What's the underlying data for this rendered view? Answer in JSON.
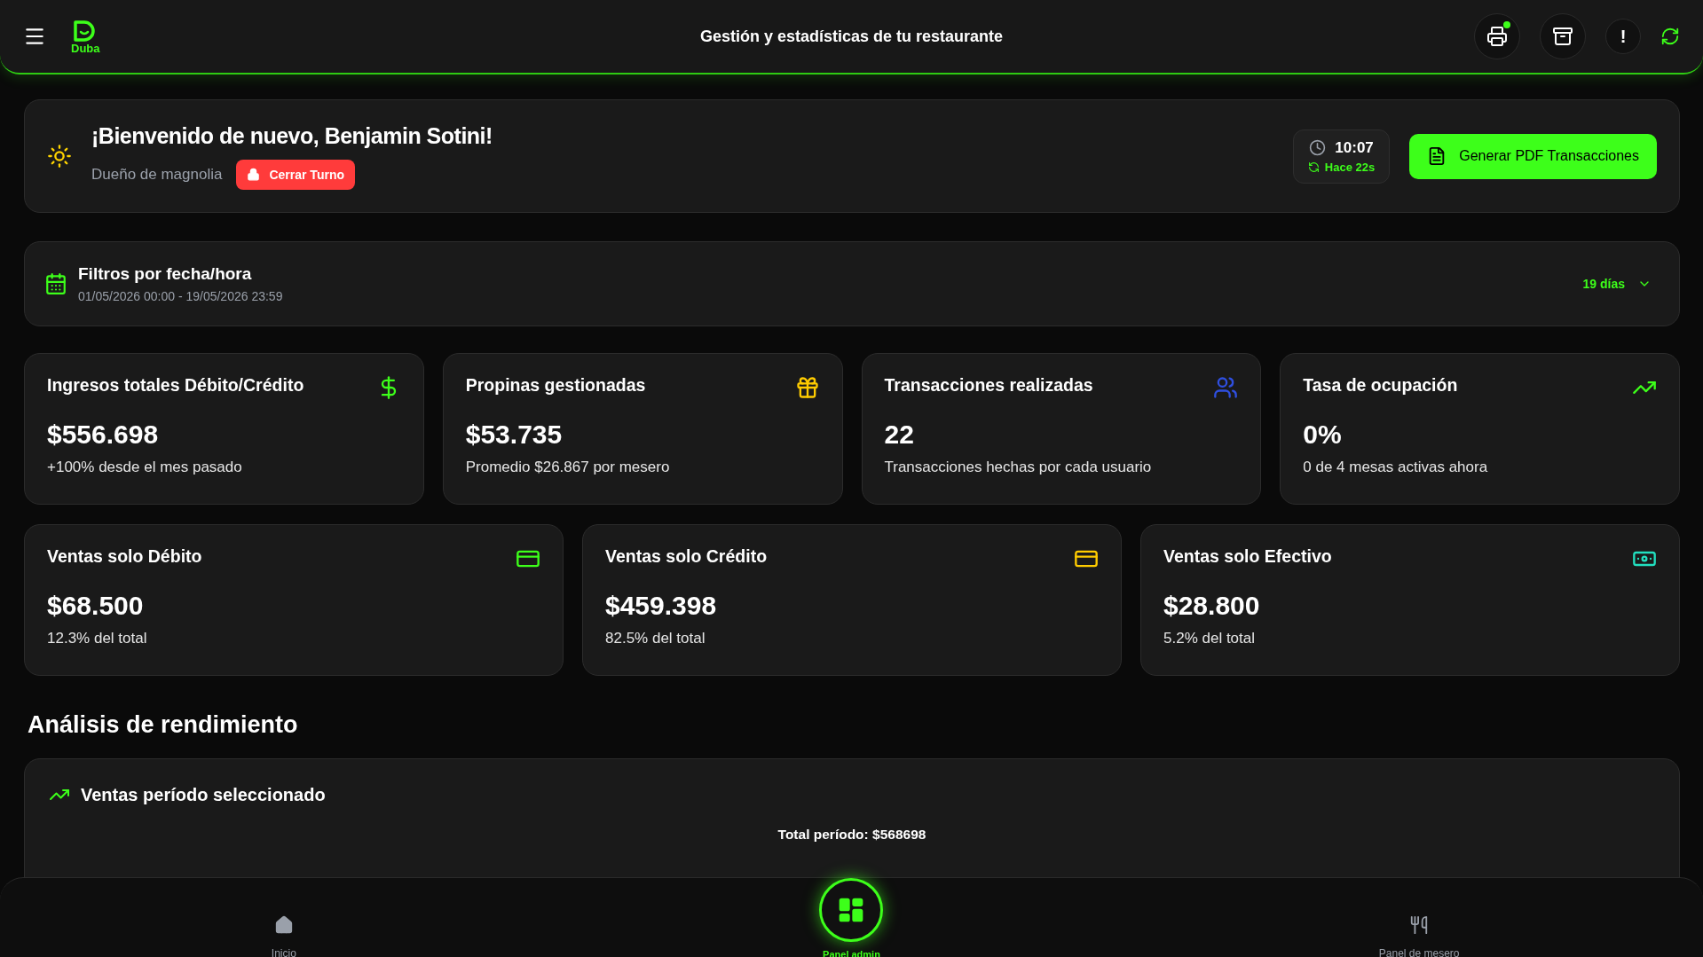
{
  "header": {
    "logo_text": "Duba",
    "title": "Gestión y estadísticas de tu restaurante",
    "actions": [
      {
        "badge": true
      },
      {
        "badge": false
      },
      {
        "label": "!",
        "badge": false
      },
      {
        "badge": false
      }
    ]
  },
  "welcome": {
    "heading": "¡Bienvenido de nuevo, Benjamin Sotini!",
    "role": "Dueño de magnolia",
    "close_shift": "Cerrar Turno",
    "time": "10:07",
    "updated": "Hace 22s",
    "pdf_button": "Generar PDF Transacciones"
  },
  "filter": {
    "title": "Filtros por fecha/hora",
    "range": "01/05/2026 00:00 - 19/05/2026 23:59",
    "period": "19 días"
  },
  "stats": [
    {
      "label": "Ingresos totales Débito/Crédito",
      "value": "$556.698",
      "note": "+100% desde el mes pasado",
      "color": "#3dff1a"
    },
    {
      "label": "Propinas gestionadas",
      "value": "$53.735",
      "note": "Promedio $26.867 por mesero",
      "color": "#ffcc00"
    },
    {
      "label": "Transacciones realizadas",
      "value": "22",
      "note": "Transacciones hechas por cada usuario",
      "color": "#2f4fe0"
    },
    {
      "label": "Tasa de ocupación",
      "value": "0%",
      "note": "0 de 4 mesas activas ahora",
      "color": "#3dff1a"
    }
  ],
  "sales": [
    {
      "label": "Ventas solo Débito",
      "value": "$68.500",
      "note": "12.3% del total",
      "color": "#3dff1a"
    },
    {
      "label": "Ventas solo Crédito",
      "value": "$459.398",
      "note": "82.5% del total",
      "color": "#ffcc00"
    },
    {
      "label": "Ventas solo Efectivo",
      "value": "$28.800",
      "note": "5.2% del total",
      "color": "#22e0c0"
    }
  ],
  "section_title": "Análisis de rendimiento",
  "chart": {
    "title": "Ventas período seleccionado",
    "total": "Total período: $568698"
  },
  "bottom_nav": [
    {
      "label": "Inicio",
      "selected": false
    },
    {
      "label": "Panel admin",
      "selected": true
    },
    {
      "label": "Panel de mesero",
      "selected": false
    }
  ]
}
